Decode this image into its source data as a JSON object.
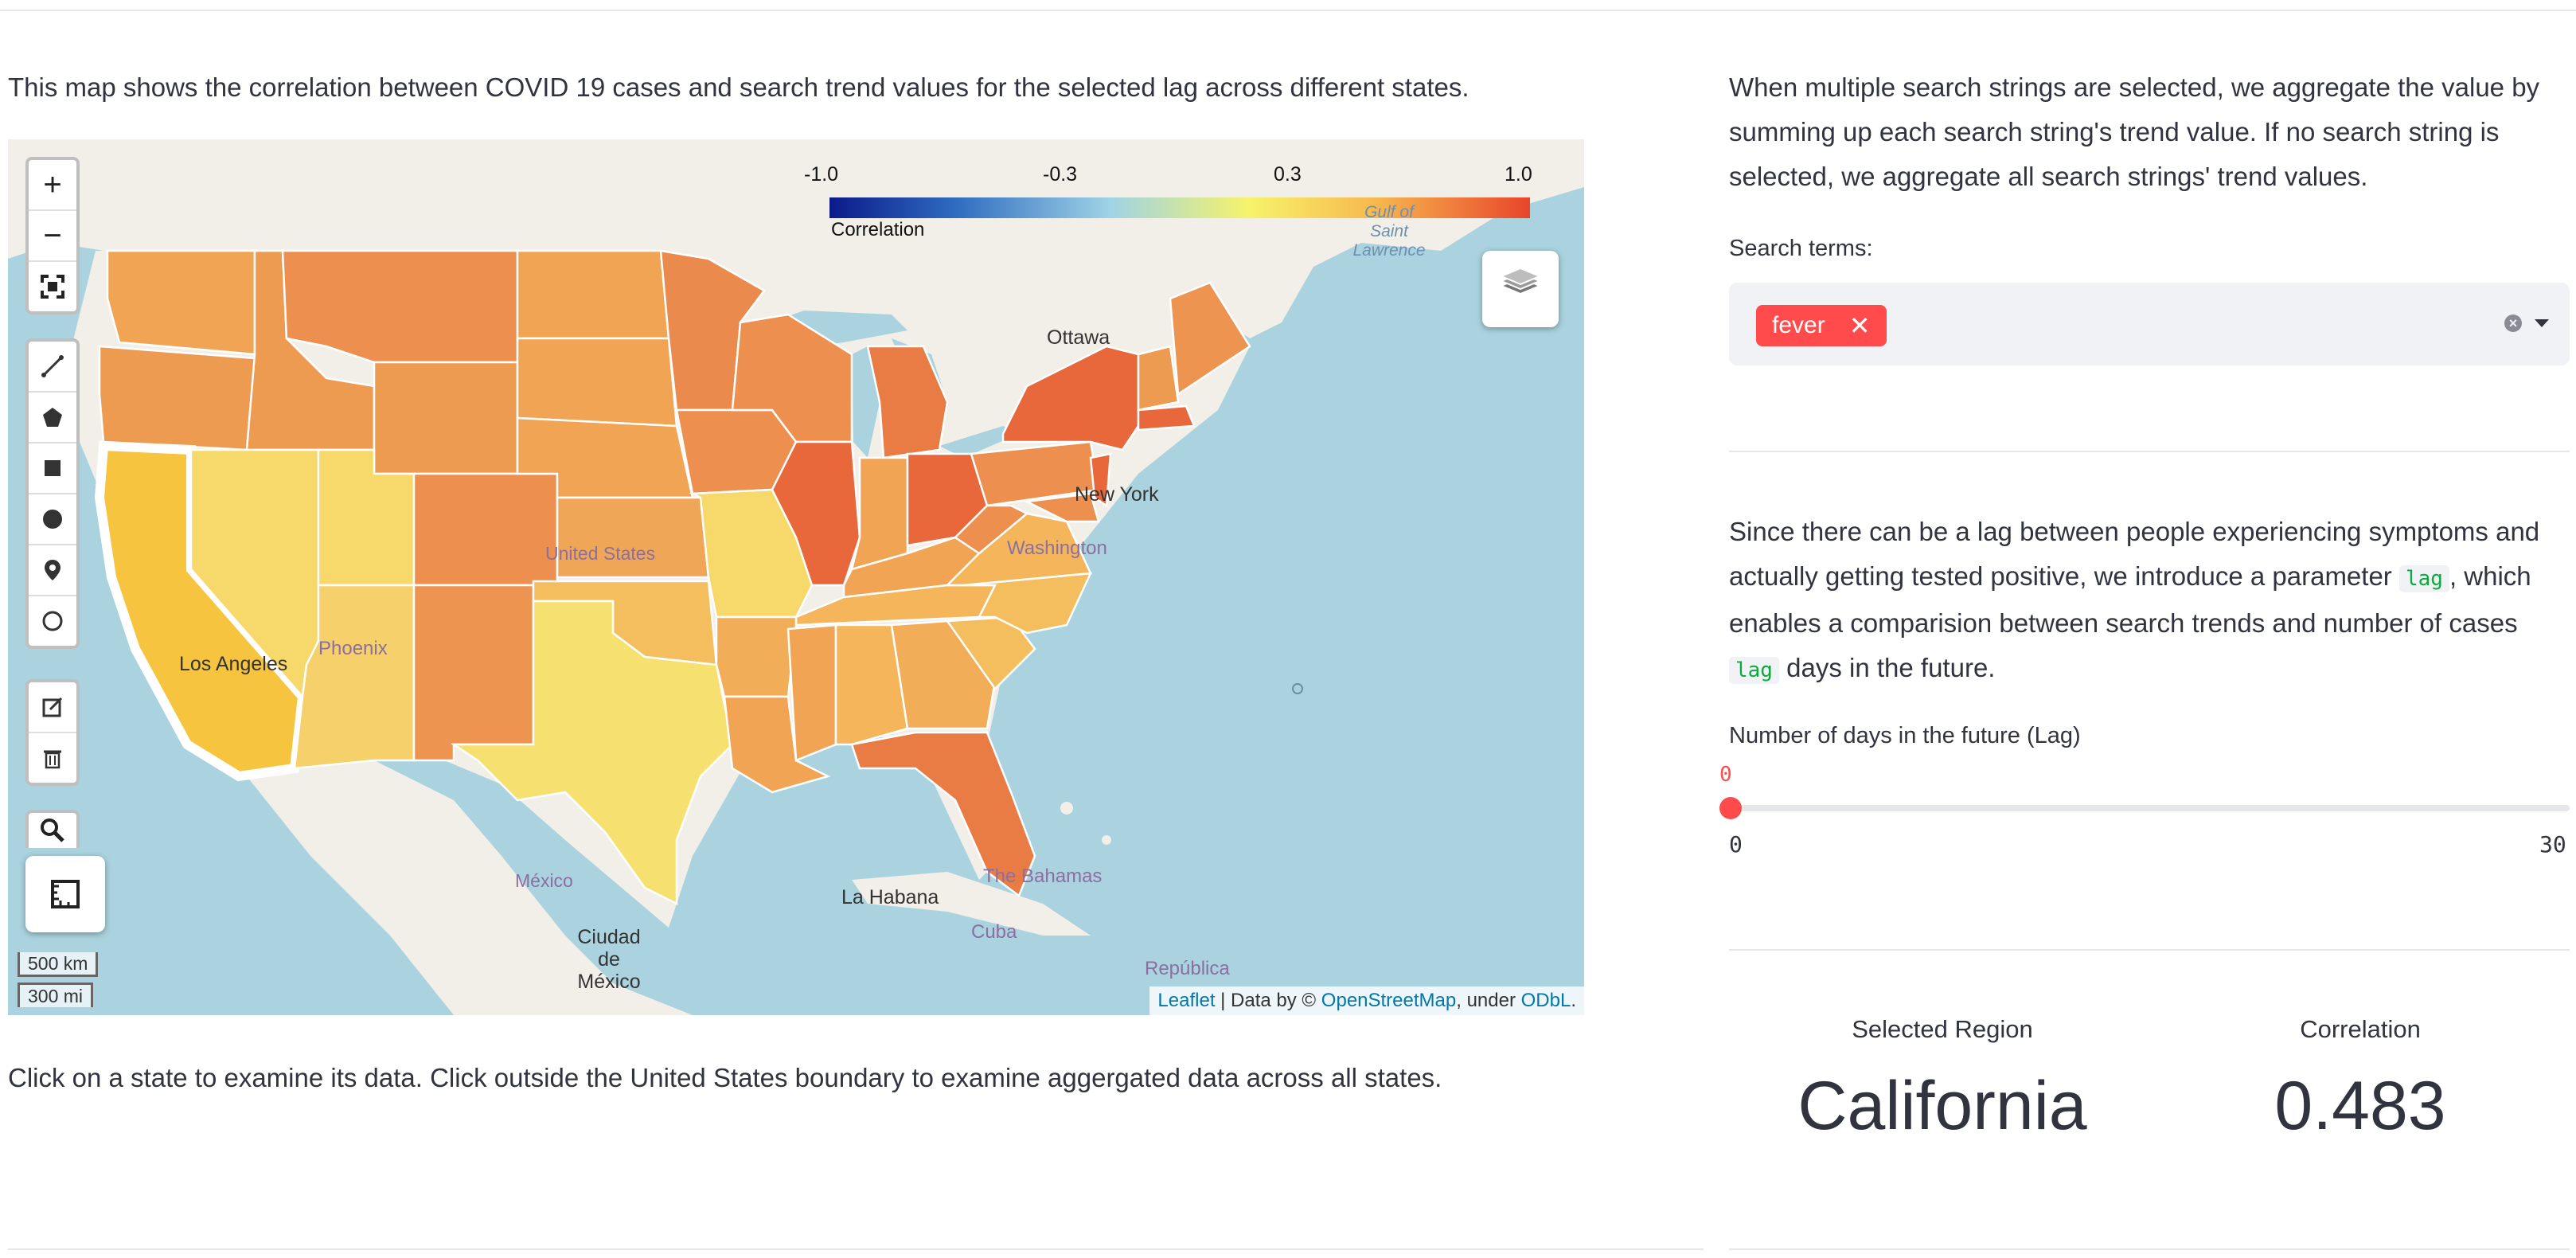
{
  "map_description": "This map shows the correlation between COVID 19 cases and search trend values for the selected lag across different states.",
  "map_footer": "Click on a state to examine its data. Click outside the United States boundary to examine aggergated data across all states.",
  "map": {
    "legend": {
      "title": "Correlation",
      "ticks": [
        "-1.0",
        "-0.3",
        "0.3",
        "1.0"
      ]
    },
    "controls": {
      "zoom_in": "+",
      "zoom_out": "−"
    },
    "labels": {
      "ottawa": "Ottawa",
      "new_york": "New York",
      "washington": "Washington",
      "united_states": "United States",
      "phoenix": "Phoenix",
      "los_angeles": "Los Angeles",
      "mexico": "México",
      "ciudad_de_mexico": "Ciudad de México",
      "la_habana": "La Habana",
      "the_bahamas": "The Bahamas",
      "cuba": "Cuba",
      "republica": "República",
      "gulf_st_lawrence": "Gulf of Saint Lawrence"
    },
    "scale": {
      "km": "500 km",
      "mi": "300 mi"
    },
    "attribution": {
      "leaflet": "Leaflet",
      "data_by": " | Data by © ",
      "osm": "OpenStreetMap",
      "under": ", under ",
      "odbl": "ODbL",
      "end": "."
    }
  },
  "aggregation_text": "When multiple search strings are selected, we aggregate the value by summing up each search string's trend value. If no search string is selected, we aggregate all search strings' trend values.",
  "search_terms": {
    "label": "Search terms:",
    "tags": [
      "fever"
    ]
  },
  "lag_text": {
    "part1": "Since there can be a lag between people experiencing symptoms and actually getting tested positive, we introduce a parameter ",
    "code1": "lag",
    "part2": ", which enables a comparision between search trends and number of cases ",
    "code2": "lag",
    "part3": " days in the future."
  },
  "slider": {
    "label": "Number of days in the future (Lag)",
    "value": "0",
    "min": "0",
    "max": "30"
  },
  "metrics": {
    "region_label": "Selected Region",
    "region_value": "California",
    "corr_label": "Correlation",
    "corr_value": "0.483"
  },
  "colors": {
    "accent": "#ff4b4b",
    "code_text": "#09ab3b",
    "state_high": "#e8452b",
    "state_mid": "#f0a455",
    "state_low": "#f7e16e"
  }
}
